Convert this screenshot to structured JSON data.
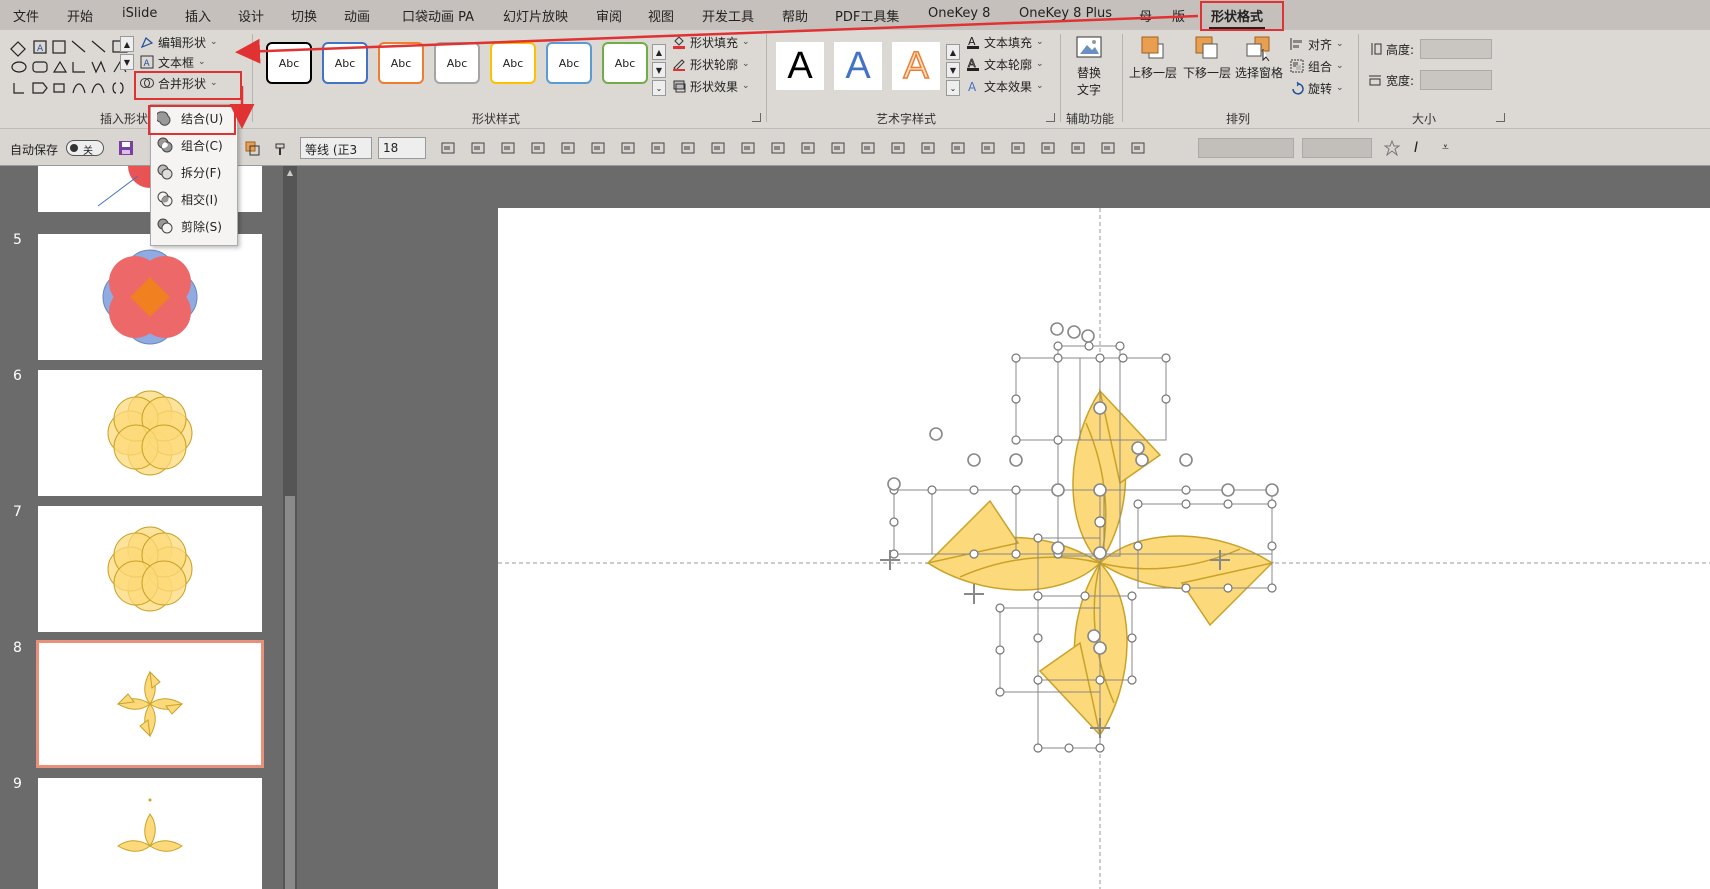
{
  "menu": {
    "items": [
      "文件",
      "开始",
      "iSlide",
      "插入",
      "设计",
      "切换",
      "动画",
      "口袋动画 PA",
      "幻灯片放映",
      "审阅",
      "视图",
      "开发工具",
      "帮助",
      "PDF工具集",
      "OneKey 8",
      "OneKey 8 Plus",
      "母",
      "版",
      "形状格式"
    ],
    "active": "形状格式"
  },
  "ribbon": {
    "insert_shapes": {
      "edit_shape": "编辑形状",
      "text_box": "文本框",
      "merge_shapes": "合并形状",
      "label": "插入形状"
    },
    "shape_styles": {
      "swatches": [
        "Abc",
        "Abc",
        "Abc",
        "Abc",
        "Abc",
        "Abc",
        "Abc"
      ],
      "swatch_colors": [
        "#000000",
        "#4472c4",
        "#ed7d31",
        "#a5a5a5",
        "#ffc000",
        "#5b9bd5",
        "#70ad47"
      ],
      "fill": "形状填充",
      "outline": "形状轮廓",
      "effects": "形状效果",
      "label": "形状样式"
    },
    "wordart": {
      "letters": [
        "A",
        "A",
        "A"
      ],
      "letter_colors": [
        "#000000",
        "#4472c4",
        "#ed7d31"
      ],
      "text_fill": "文本填充",
      "text_outline": "文本轮廓",
      "text_effects": "文本效果",
      "label": "艺术字样式"
    },
    "accessibility": {
      "alt_text_line1": "替换",
      "alt_text_line2": "文字",
      "label": "辅助功能"
    },
    "arrange": {
      "bring_forward": "上移一层",
      "send_backward": "下移一层",
      "selection_pane": "选择窗格",
      "align": "对齐",
      "group": "组合",
      "rotate": "旋转",
      "label": "排列"
    },
    "size": {
      "height_label": "高度:",
      "width_label": "宽度:",
      "height_value": "",
      "width_value": "",
      "label": "大小"
    }
  },
  "qat": {
    "autosave_label": "自动保存",
    "autosave_state": "关",
    "font_name": "等线 (正3",
    "font_size": "18"
  },
  "merge_dropdown": {
    "items": [
      {
        "label": "结合(U)"
      },
      {
        "label": "组合(C)"
      },
      {
        "label": "拆分(F)"
      },
      {
        "label": "相交(I)"
      },
      {
        "label": "剪除(S)"
      }
    ]
  },
  "slides": {
    "numbers": [
      "5",
      "6",
      "7",
      "8",
      "9"
    ],
    "selected": "8"
  },
  "colors": {
    "accent_red": "#e03232",
    "shape_fill": "#fcd97a",
    "shape_stroke": "#c9a227",
    "selection_border": "#e8907a"
  }
}
